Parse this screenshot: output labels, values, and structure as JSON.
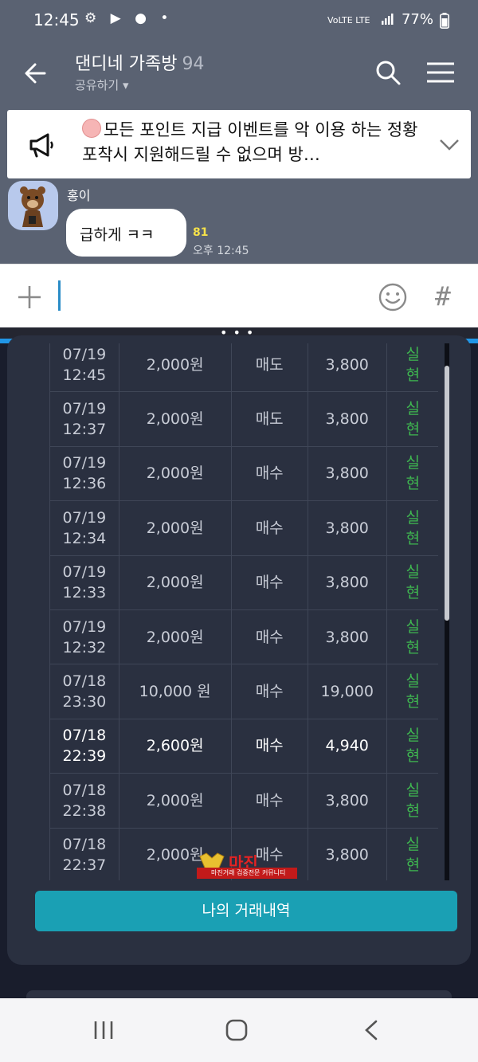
{
  "status_bar": {
    "time": "12:45",
    "icons": "⚙ ▶ ● •",
    "network": "VoLTE LTE",
    "battery": "77%"
  },
  "chat": {
    "title": "댄디네 가족방",
    "member_count": "94",
    "share_label": "공유하기 ▾",
    "notice_text": "모든 포인트 지급 이벤트를 악 이용 하는 정황 포착시 지원해드릴 수 없으며 방…",
    "sender": "홍이",
    "message": "급하게 ㅋㅋ",
    "unread_count": "81",
    "message_time": "오후 12:45"
  },
  "input": {
    "placeholder": ""
  },
  "trade_table": {
    "rows": [
      {
        "date": "07/19",
        "time": "12:45",
        "amount": "2,000원",
        "type": "매도",
        "price": "3,800",
        "status1": "실",
        "status2": "현"
      },
      {
        "date": "07/19",
        "time": "12:37",
        "amount": "2,000원",
        "type": "매도",
        "price": "3,800",
        "status1": "실",
        "status2": "현"
      },
      {
        "date": "07/19",
        "time": "12:36",
        "amount": "2,000원",
        "type": "매수",
        "price": "3,800",
        "status1": "실",
        "status2": "현"
      },
      {
        "date": "07/19",
        "time": "12:34",
        "amount": "2,000원",
        "type": "매수",
        "price": "3,800",
        "status1": "실",
        "status2": "현"
      },
      {
        "date": "07/19",
        "time": "12:33",
        "amount": "2,000원",
        "type": "매수",
        "price": "3,800",
        "status1": "실",
        "status2": "현"
      },
      {
        "date": "07/19",
        "time": "12:32",
        "amount": "2,000원",
        "type": "매수",
        "price": "3,800",
        "status1": "실",
        "status2": "현"
      },
      {
        "date": "07/18",
        "time": "23:30",
        "amount": "10,000 원",
        "type": "매수",
        "price": "19,000",
        "status1": "실",
        "status2": "현"
      },
      {
        "date": "07/18",
        "time": "22:39",
        "amount": "2,600원",
        "type": "매수",
        "price": "4,940",
        "status1": "실",
        "status2": "현"
      },
      {
        "date": "07/18",
        "time": "22:38",
        "amount": "2,000원",
        "type": "매수",
        "price": "3,800",
        "status1": "실",
        "status2": "현"
      },
      {
        "date": "07/18",
        "time": "22:37",
        "amount": "2,000원",
        "type": "매수",
        "price": "3,800",
        "status1": "실",
        "status2": "현"
      }
    ],
    "highlighted_index": 7
  },
  "history_button": "나의 거래내역",
  "watermark": {
    "title": "마진",
    "subtitle": "마진거래 검증전문 커뮤니티"
  },
  "colors": {
    "header_bg": "#5a6272",
    "app_bg": "#191d2c",
    "card_bg": "#2a3040",
    "status_green": "#3fb850",
    "button_teal": "#1aa0b4",
    "accent_blue": "#2196e6"
  }
}
